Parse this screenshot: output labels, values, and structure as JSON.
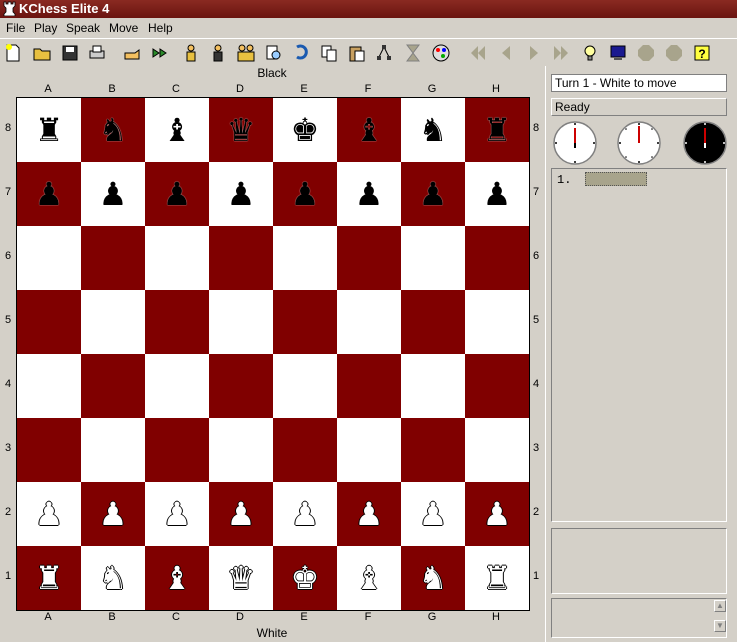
{
  "window": {
    "title": "KChess Elite 4"
  },
  "menu": [
    "File",
    "Play",
    "Speak",
    "Move",
    "Help"
  ],
  "toolbar": {
    "icons": [
      "new-game-icon",
      "open-icon",
      "save-icon",
      "print-icon",
      "hint-hand-icon",
      "play-forward-icon",
      "human-player-icon",
      "computer-player-icon",
      "two-players-icon",
      "analyze-icon",
      "undo-icon",
      "copy-icon",
      "paste-icon",
      "tree-icon",
      "hourglass-icon",
      "palette-icon",
      "first-move-icon",
      "previous-move-icon",
      "next-move-icon",
      "last-move-icon",
      "lightbulb-icon",
      "monitor-icon",
      "stop-icon",
      "pause-icon",
      "help-icon"
    ]
  },
  "board": {
    "top_label": "Black",
    "bottom_label": "White",
    "files": [
      "A",
      "B",
      "C",
      "D",
      "E",
      "F",
      "G",
      "H"
    ],
    "ranks": [
      "8",
      "7",
      "6",
      "5",
      "4",
      "3",
      "2",
      "1"
    ],
    "colors": {
      "dark": "#800000",
      "light": "#ffffff"
    },
    "position": [
      [
        "r",
        "n",
        "b",
        "q",
        "k",
        "b",
        "n",
        "r"
      ],
      [
        "p",
        "p",
        "p",
        "p",
        "p",
        "p",
        "p",
        "p"
      ],
      [
        "",
        "",
        "",
        "",
        "",
        "",
        "",
        ""
      ],
      [
        "",
        "",
        "",
        "",
        "",
        "",
        "",
        ""
      ],
      [
        "",
        "",
        "",
        "",
        "",
        "",
        "",
        ""
      ],
      [
        "",
        "",
        "",
        "",
        "",
        "",
        "",
        ""
      ],
      [
        "P",
        "P",
        "P",
        "P",
        "P",
        "P",
        "P",
        "P"
      ],
      [
        "R",
        "N",
        "B",
        "Q",
        "K",
        "B",
        "N",
        "R"
      ]
    ]
  },
  "status": {
    "turn": "Turn 1 - White to move",
    "state": "Ready"
  },
  "moves": {
    "first_number": "1."
  }
}
